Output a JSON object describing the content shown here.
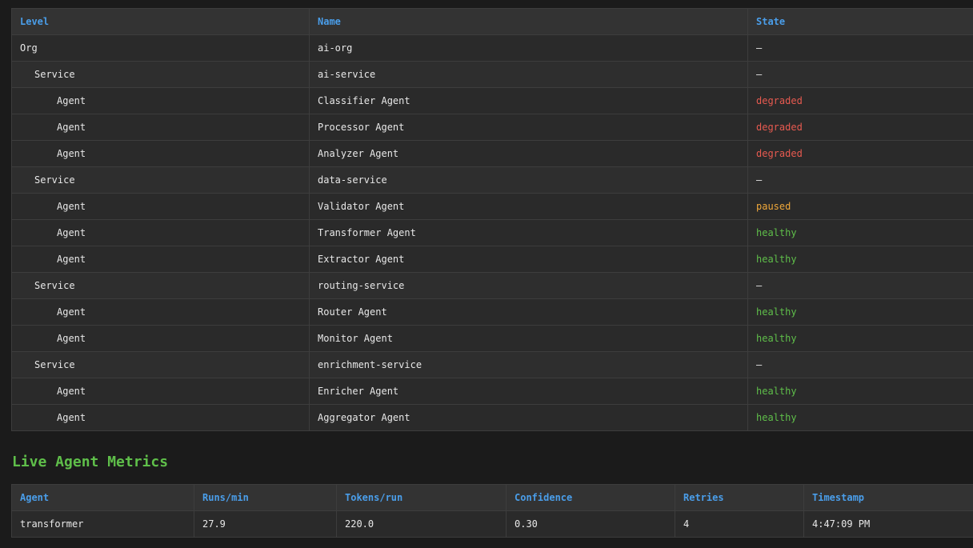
{
  "hierarchy": {
    "headers": {
      "level": "Level",
      "name": "Name",
      "state": "State"
    },
    "rows": [
      {
        "level": "Org",
        "name": "ai-org",
        "state": "–",
        "depth": 0,
        "status": "none"
      },
      {
        "level": "Service",
        "name": "ai-service",
        "state": "–",
        "depth": 1,
        "status": "none"
      },
      {
        "level": "Agent",
        "name": "Classifier Agent",
        "state": "degraded",
        "depth": 2,
        "status": "degraded"
      },
      {
        "level": "Agent",
        "name": "Processor Agent",
        "state": "degraded",
        "depth": 2,
        "status": "degraded"
      },
      {
        "level": "Agent",
        "name": "Analyzer Agent",
        "state": "degraded",
        "depth": 2,
        "status": "degraded"
      },
      {
        "level": "Service",
        "name": "data-service",
        "state": "–",
        "depth": 1,
        "status": "none"
      },
      {
        "level": "Agent",
        "name": "Validator Agent",
        "state": "paused",
        "depth": 2,
        "status": "paused"
      },
      {
        "level": "Agent",
        "name": "Transformer Agent",
        "state": "healthy",
        "depth": 2,
        "status": "healthy"
      },
      {
        "level": "Agent",
        "name": "Extractor Agent",
        "state": "healthy",
        "depth": 2,
        "status": "healthy"
      },
      {
        "level": "Service",
        "name": "routing-service",
        "state": "–",
        "depth": 1,
        "status": "none"
      },
      {
        "level": "Agent",
        "name": "Router Agent",
        "state": "healthy",
        "depth": 2,
        "status": "healthy"
      },
      {
        "level": "Agent",
        "name": "Monitor Agent",
        "state": "healthy",
        "depth": 2,
        "status": "healthy"
      },
      {
        "level": "Service",
        "name": "enrichment-service",
        "state": "–",
        "depth": 1,
        "status": "none"
      },
      {
        "level": "Agent",
        "name": "Enricher Agent",
        "state": "healthy",
        "depth": 2,
        "status": "healthy"
      },
      {
        "level": "Agent",
        "name": "Aggregator Agent",
        "state": "healthy",
        "depth": 2,
        "status": "healthy"
      }
    ]
  },
  "metrics": {
    "title": "Live Agent Metrics",
    "headers": {
      "agent": "Agent",
      "runs": "Runs/min",
      "tokens": "Tokens/run",
      "confidence": "Confidence",
      "retries": "Retries",
      "timestamp": "Timestamp"
    },
    "rows": [
      {
        "agent": "transformer",
        "runs": "27.9",
        "tokens": "220.0",
        "confidence": "0.30",
        "retries": "4",
        "timestamp": "4:47:09 PM"
      }
    ]
  },
  "colors": {
    "background": "#1b1b1b",
    "header_text": "#4a9eea",
    "title_text": "#5fbf4a",
    "degraded": "#e85a50",
    "paused": "#f0a83a",
    "healthy": "#5fbf4a"
  }
}
